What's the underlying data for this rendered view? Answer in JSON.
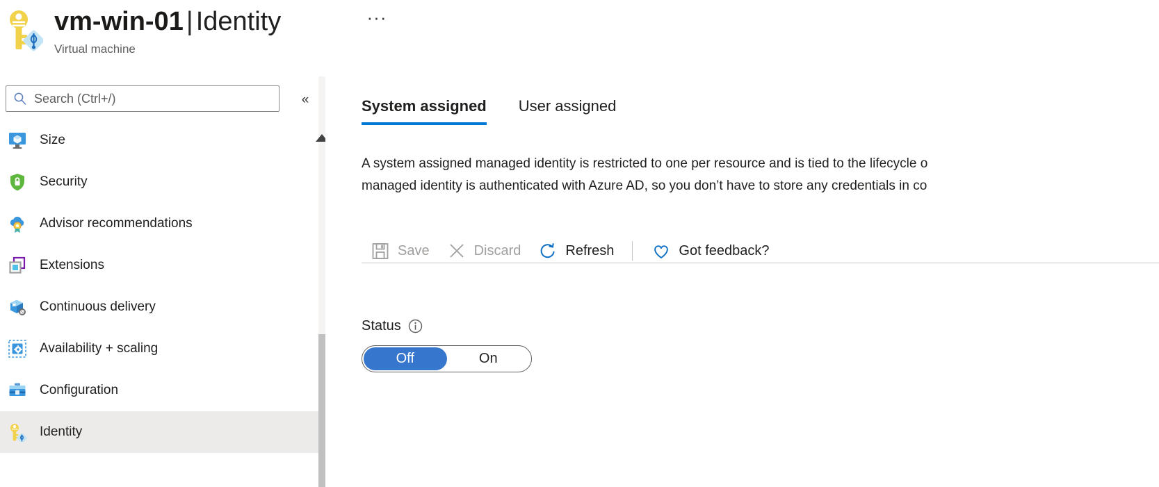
{
  "header": {
    "resource_name": "vm-win-01",
    "separator": "|",
    "page_name": "Identity",
    "subtitle": "Virtual machine",
    "more_menu_label": "···",
    "resource_icon": "key-ad-icon"
  },
  "sidebar": {
    "search": {
      "placeholder": "Search (Ctrl+/)",
      "value": "",
      "icon": "search-icon"
    },
    "collapse_label": "«",
    "items": [
      {
        "label": "Size",
        "icon": "monitor-size-icon",
        "selected": false
      },
      {
        "label": "Security",
        "icon": "shield-lock-icon",
        "selected": false
      },
      {
        "label": "Advisor recommendations",
        "icon": "cloud-award-icon",
        "selected": false
      },
      {
        "label": "Extensions",
        "icon": "extensions-icon",
        "selected": false
      },
      {
        "label": "Continuous delivery",
        "icon": "package-delivery-icon",
        "selected": false
      },
      {
        "label": "Availability + scaling",
        "icon": "availability-scaling-icon",
        "selected": false
      },
      {
        "label": "Configuration",
        "icon": "toolbox-configuration-icon",
        "selected": false
      },
      {
        "label": "Identity",
        "icon": "key-identity-icon",
        "selected": true
      }
    ],
    "scrollbar": {
      "up_arrow_icon": "scroll-up-arrow-icon"
    }
  },
  "main": {
    "tabs": [
      {
        "label": "System assigned",
        "active": true
      },
      {
        "label": "User assigned",
        "active": false
      }
    ],
    "description_line1": "A system assigned managed identity is restricted to one per resource and is tied to the lifecycle o",
    "description_line2": "managed identity is authenticated with Azure AD, so you don’t have to store any credentials in co",
    "commands": [
      {
        "label": "Save",
        "icon": "save-disk-icon",
        "disabled": true
      },
      {
        "label": "Discard",
        "icon": "discard-x-icon",
        "disabled": true
      },
      {
        "label": "Refresh",
        "icon": "refresh-icon",
        "disabled": false
      },
      {
        "label": "Got feedback?",
        "icon": "heart-feedback-icon",
        "disabled": false
      }
    ],
    "status": {
      "label": "Status",
      "info_icon": "info-circle-icon",
      "options": [
        {
          "label": "Off",
          "selected": true
        },
        {
          "label": "On",
          "selected": false
        }
      ]
    }
  },
  "colors": {
    "accent": "#0078d4",
    "toggle_selected": "#3776cd",
    "selected_row": "#edebe9",
    "disabled_text": "#a19f9d"
  }
}
